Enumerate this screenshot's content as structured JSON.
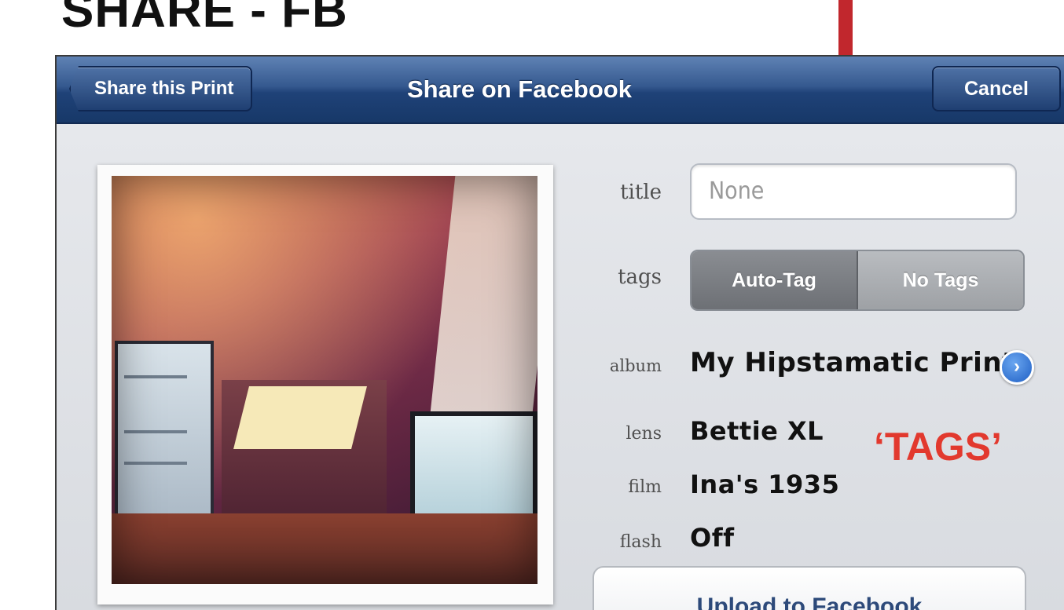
{
  "slide": {
    "heading": "SHARE - FB",
    "callout": "‘TAGS’",
    "accent_color": "#c1272d",
    "callout_color": "#e2392e"
  },
  "navbar": {
    "back_label": "Share this Print",
    "title": "Share on Facebook",
    "cancel_label": "Cancel"
  },
  "form": {
    "title_label": "title",
    "title_placeholder": "None",
    "tags_label": "tags",
    "tags_options": [
      "Auto-Tag",
      "No Tags"
    ],
    "tags_selected": "Auto-Tag",
    "album_label": "album",
    "album_value": "My Hipstamatic Prints",
    "lens_label": "lens",
    "lens_value": "Bettie XL",
    "film_label": "film",
    "film_value": "Ina's 1935",
    "flash_label": "flash",
    "flash_value": "Off",
    "upload_label": "Upload to Facebook"
  },
  "icons": {
    "disclosure": "chevron-right-circle-icon"
  }
}
